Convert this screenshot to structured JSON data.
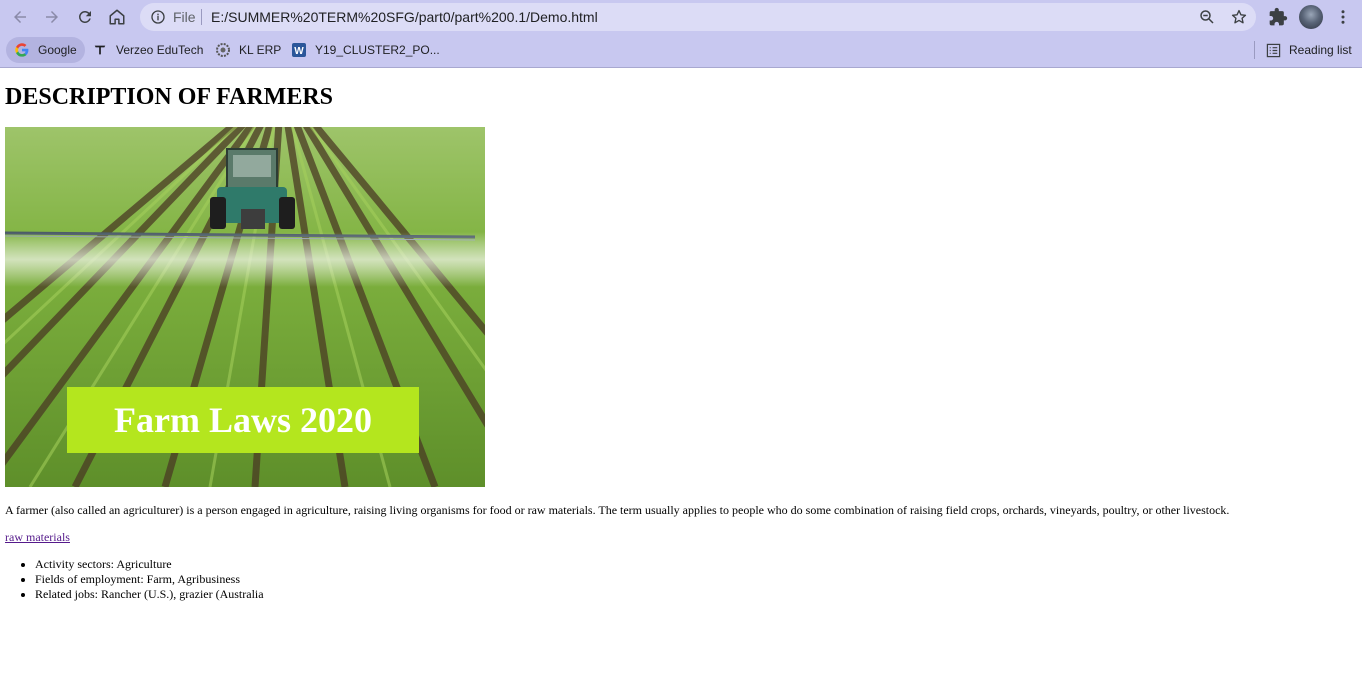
{
  "browser": {
    "omnibox": {
      "scheme_label": "File",
      "url": "E:/SUMMER%20TERM%20SFG/part0/part%200.1/Demo.html"
    },
    "bookmarks": [
      {
        "label": "Google",
        "icon": "google-icon"
      },
      {
        "label": "Verzeo EduTech",
        "icon": "verzeo-icon"
      },
      {
        "label": "KL ERP",
        "icon": "kl-erp-icon"
      },
      {
        "label": "Y19_CLUSTER2_PO...",
        "icon": "word-doc-icon"
      }
    ],
    "reading_list_label": "Reading list",
    "colors": {
      "chrome": "#c8c8f0",
      "omnibox": "#dcdcf6"
    }
  },
  "page": {
    "heading": "DESCRIPTION OF FARMERS",
    "image_caption": "Farm Laws 2020",
    "description": "A farmer (also called an agriculturer) is a person engaged in agriculture, raising living organisms for food or raw materials. The term usually applies to people who do some combination of raising field crops, orchards, vineyards, poultry, or other livestock.",
    "link_text": "raw materials",
    "facts": [
      "Activity sectors: Agriculture",
      "Fields of employment: Farm, Agribusiness",
      "Related jobs: Rancher (U.S.), grazier (Australia"
    ],
    "colors": {
      "banner": "#b4e61e",
      "link": "#551a8b"
    }
  }
}
